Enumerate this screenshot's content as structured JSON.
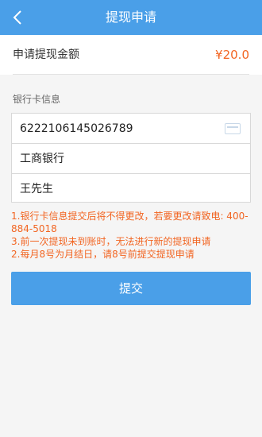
{
  "header": {
    "title": "提现申请",
    "back_icon": "chevron-left-icon"
  },
  "amount": {
    "label": "申请提现金额",
    "value": "¥20.0"
  },
  "bank_card": {
    "section_label": "银行卡信息",
    "card_number": "6222106145026789",
    "bank_name": "工商银行",
    "holder_name": "王先生",
    "card_icon": "bank-card-icon"
  },
  "notes": {
    "line1": "1.银行卡信息提交后将不得更改，若要更改请致电: 400-884-5018",
    "line2": "3.前一次提现未到账时，无法进行新的提现申请",
    "line3": "2.每月8号为月结日，请8号前提交提现申请"
  },
  "submit_label": "提交",
  "colors": {
    "primary": "#4a9fe8",
    "accent": "#f26522"
  }
}
